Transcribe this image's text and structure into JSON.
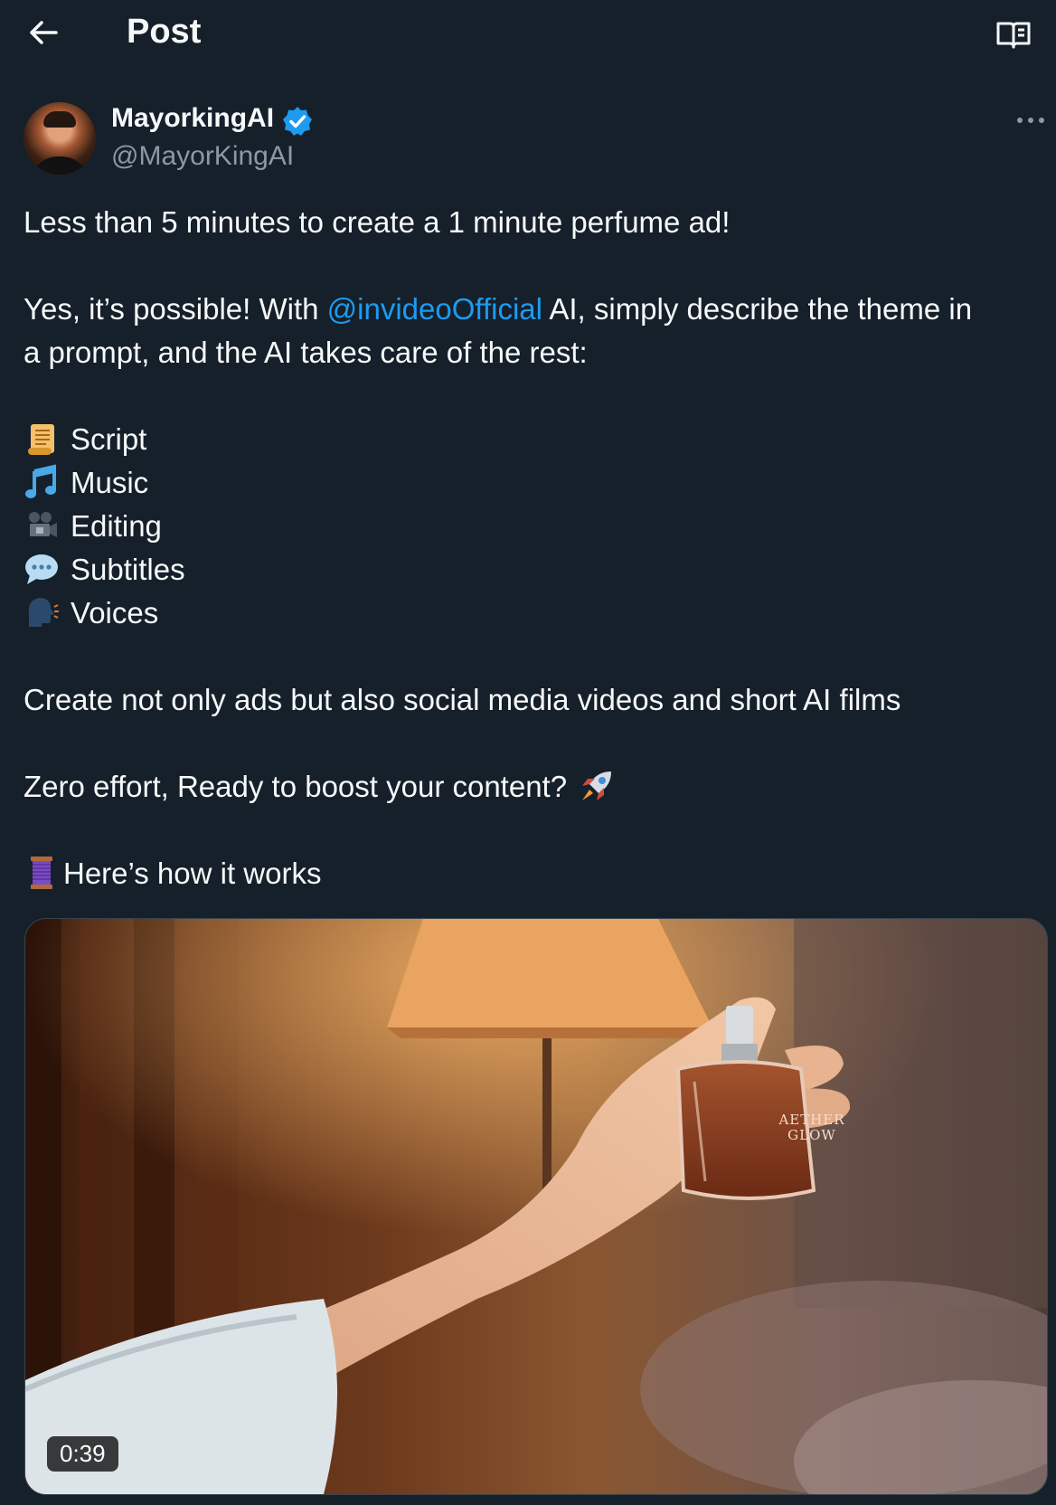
{
  "header": {
    "title": "Post",
    "back_icon": "arrow-left-icon",
    "reader_icon": "open-book-icon"
  },
  "author": {
    "name": "MayorkingAI",
    "handle": "@MayorKingAI",
    "verified": true,
    "verified_color": "#1d9bf0",
    "more_icon": "more-horizontal-icon"
  },
  "tweet": {
    "line1": "Less than 5 minutes to create a 1 minute perfume ad!",
    "line2_before": "Yes, it’s possible! With ",
    "line2_mention": "@invideoOfficial",
    "line2_after": " AI, simply describe the theme in",
    "line3": "a prompt, and the AI takes care of the rest:",
    "features": [
      {
        "icon": "scroll-emoji",
        "label": "Script"
      },
      {
        "icon": "music-note-emoji",
        "label": "Music"
      },
      {
        "icon": "film-camera-emoji",
        "label": "Editing"
      },
      {
        "icon": "speech-bubble-emoji",
        "label": "Subtitles"
      },
      {
        "icon": "speaking-head-emoji",
        "label": "Voices"
      }
    ],
    "line4": "Create not only ads but also social media videos and short AI films",
    "line5": "Zero effort, Ready to boost your content?",
    "line5_icon": "rocket-emoji",
    "line6_icon": "thread-spool-emoji",
    "line6": "Here’s how it works"
  },
  "media": {
    "type": "video",
    "duration": "0:39",
    "bottle_text_line1": "AETHER",
    "bottle_text_line2": "GLOW"
  },
  "colors": {
    "background": "#15202b",
    "text": "#f7f9f9",
    "secondary_text": "#8b98a5",
    "accent": "#1d9bf0"
  }
}
